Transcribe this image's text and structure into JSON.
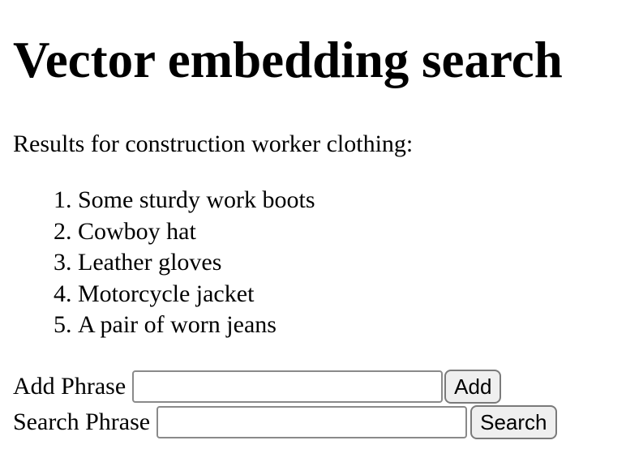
{
  "page": {
    "title": "Vector embedding search",
    "results_heading": "Results for construction worker clothing:",
    "results": [
      "Some sturdy work boots",
      "Cowboy hat",
      "Leather gloves",
      "Motorcycle jacket",
      "A pair of worn jeans"
    ]
  },
  "add_form": {
    "label": "Add Phrase",
    "value": "",
    "button_label": "Add"
  },
  "search_form": {
    "label": "Search Phrase",
    "value": "",
    "button_label": "Search"
  }
}
